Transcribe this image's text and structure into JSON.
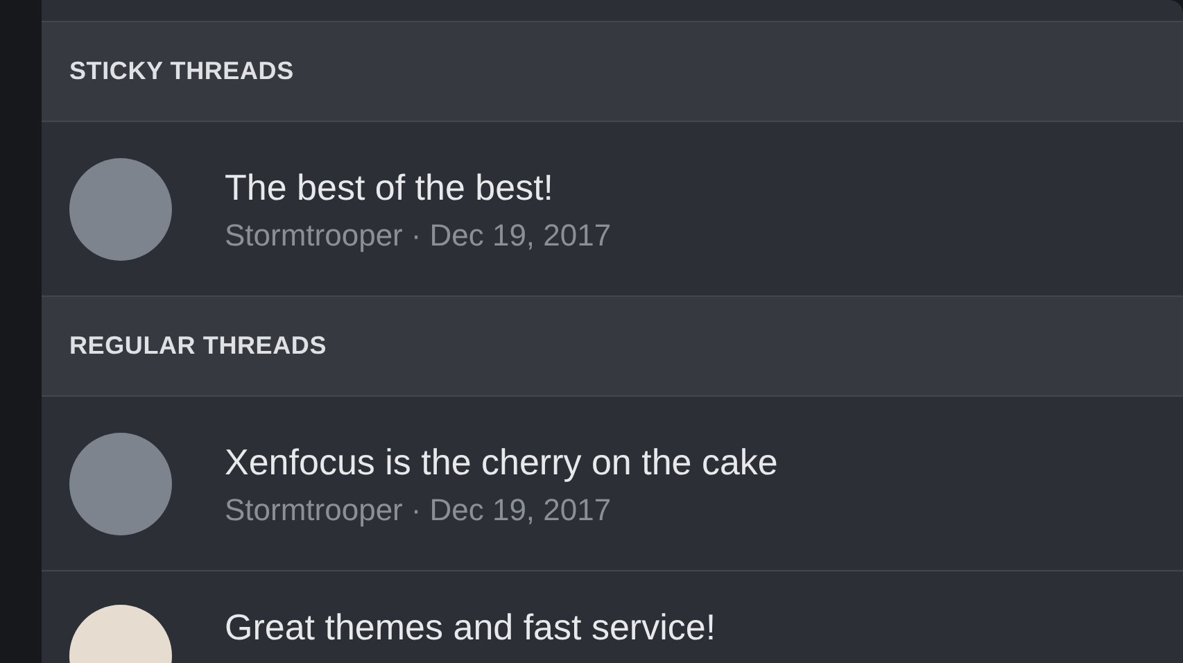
{
  "sections": [
    {
      "heading": "STICKY THREADS",
      "threads": [
        {
          "title": "The best of the best!",
          "author": "Stormtrooper",
          "separator": "·",
          "date": "Dec 19, 2017"
        }
      ]
    },
    {
      "heading": "REGULAR THREADS",
      "threads": [
        {
          "title": "Xenfocus is the cherry on the cake",
          "author": "Stormtrooper",
          "separator": "·",
          "date": "Dec 19, 2017"
        },
        {
          "title": "Great themes and fast service!"
        }
      ]
    }
  ]
}
